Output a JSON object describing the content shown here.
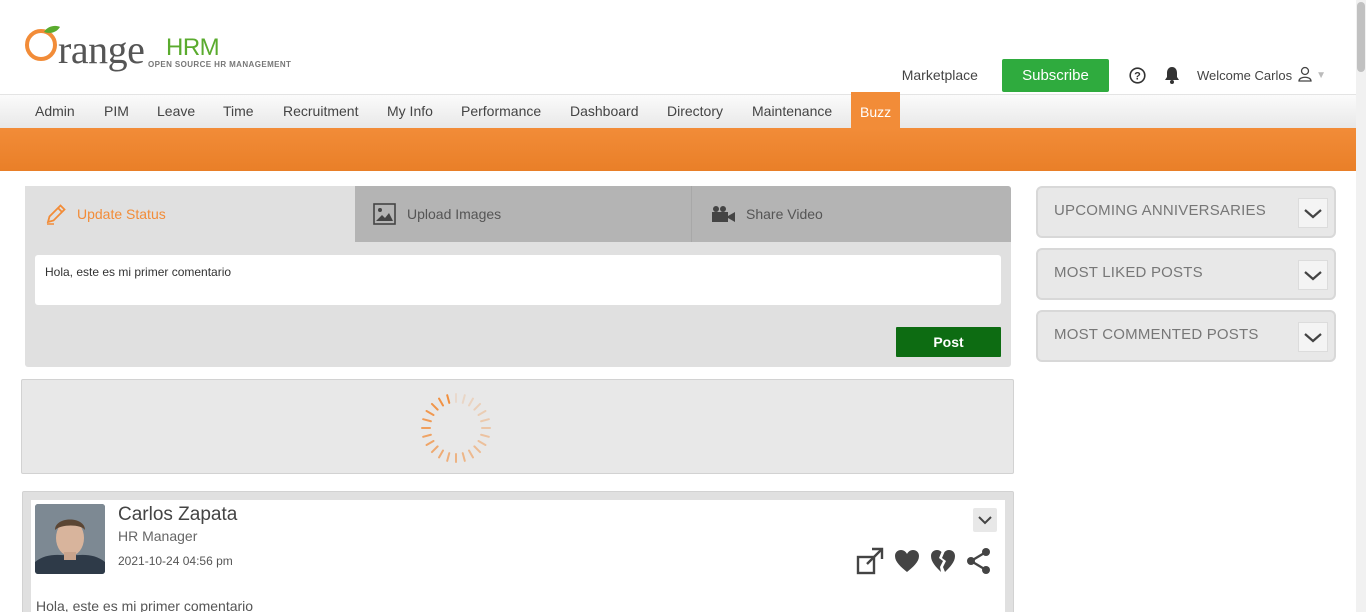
{
  "brand": {
    "logo_word": "range",
    "logo_hrm": "HRM",
    "logo_tagline": "OPEN SOURCE HR MANAGEMENT",
    "accent": "#f28c38",
    "green": "#5aab2e"
  },
  "header": {
    "marketplace": "Marketplace",
    "subscribe": "Subscribe",
    "welcome": "Welcome Carlos"
  },
  "nav": {
    "items": [
      "Admin",
      "PIM",
      "Leave",
      "Time",
      "Recruitment",
      "My Info",
      "Performance",
      "Dashboard",
      "Directory",
      "Maintenance",
      "Buzz"
    ],
    "active": "Buzz"
  },
  "status": {
    "tabs": {
      "update": "Update Status",
      "upload": "Upload Images",
      "video": "Share Video"
    },
    "input_value": "Hola, este es mi primer comentario",
    "post_button": "Post"
  },
  "post": {
    "author": "Carlos Zapata",
    "job_title": "HR Manager",
    "date": "2021-10-24 04:56 pm",
    "text": "Hola, este es mi primer comentario"
  },
  "sidebar": {
    "widgets": [
      "UPCOMING ANNIVERSARIES",
      "MOST LIKED POSTS",
      "MOST COMMENTED POSTS"
    ]
  }
}
